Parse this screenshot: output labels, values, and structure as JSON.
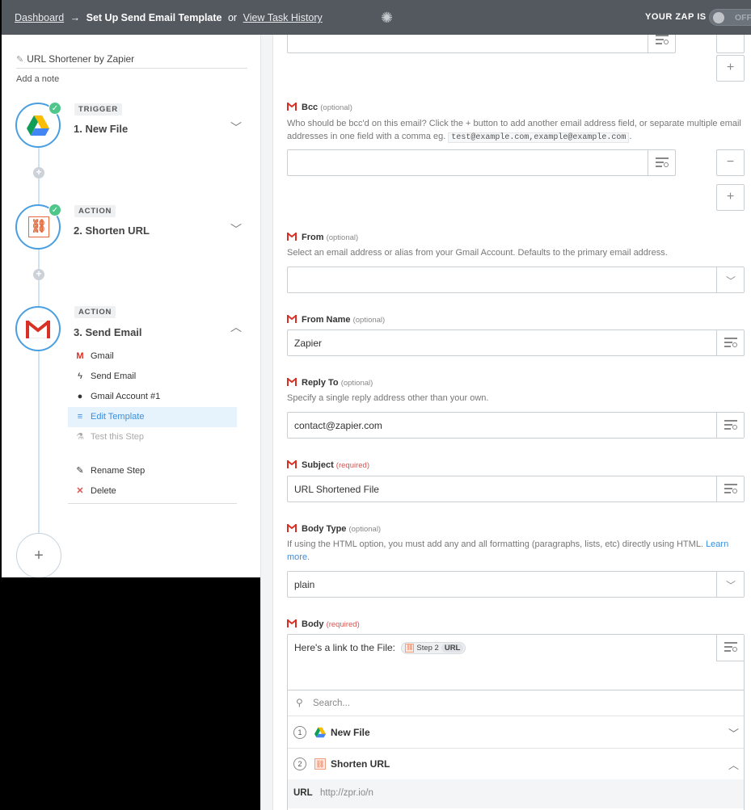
{
  "topbar": {
    "dashboard": "Dashboard",
    "arrow": "→",
    "current": "Set Up Send Email Template",
    "or": "or",
    "history": "View Task History",
    "zap_is": "YOUR ZAP IS",
    "toggle_state": "OFF"
  },
  "sidebar": {
    "zap_name": "URL Shortener by Zapier",
    "add_note": "Add a note",
    "steps": [
      {
        "badge": "TRIGGER",
        "title": "1. New File"
      },
      {
        "badge": "ACTION",
        "title": "2. Shorten URL"
      },
      {
        "badge": "ACTION",
        "title": "3. Send Email"
      }
    ],
    "submenu": {
      "app": "Gmail",
      "event": "Send Email",
      "account": "Gmail Account #1",
      "template": "Edit Template",
      "test": "Test this Step",
      "rename": "Rename Step",
      "delete": "Delete"
    }
  },
  "form": {
    "bcc": {
      "label": "Bcc",
      "tag": "(optional)",
      "help": "Who should be bcc'd on this email? Click the + button to add another email address field, or separate multiple email addresses in one field with a comma eg.",
      "example": "test@example.com,example@example.com",
      "after": ".",
      "value": ""
    },
    "from": {
      "label": "From",
      "tag": "(optional)",
      "help": "Select an email address or alias from your Gmail Account. Defaults to the primary email address.",
      "value": ""
    },
    "from_name": {
      "label": "From Name",
      "tag": "(optional)",
      "value": "Zapier"
    },
    "reply_to": {
      "label": "Reply To",
      "tag": "(optional)",
      "help": "Specify a single reply address other than your own.",
      "value": "contact@zapier.com"
    },
    "subject": {
      "label": "Subject",
      "tag": "(required)",
      "value": "URL Shortened File"
    },
    "body_type": {
      "label": "Body Type",
      "tag": "(optional)",
      "help": "If using the HTML option, you must add any and all formatting (paragraphs, lists, etc) directly using HTML.",
      "learn": "Learn more.",
      "value": "plain"
    },
    "body": {
      "label": "Body",
      "tag": "(required)",
      "text": "Here's a link to the File:",
      "pill_step": "Step 2",
      "pill_field": "URL"
    },
    "buttons": {
      "plus": "+",
      "minus": "−"
    }
  },
  "dropdown": {
    "search_placeholder": "Search...",
    "rows": [
      {
        "num": "1",
        "title": "New File"
      },
      {
        "num": "2",
        "title": "Shorten URL"
      }
    ],
    "url_key": "URL",
    "url_value": "http://zpr.io/n"
  },
  "colors": {
    "topbar": "#54595f",
    "accent": "#3b8ede",
    "success": "#4fc78b",
    "required": "#d9534f"
  }
}
